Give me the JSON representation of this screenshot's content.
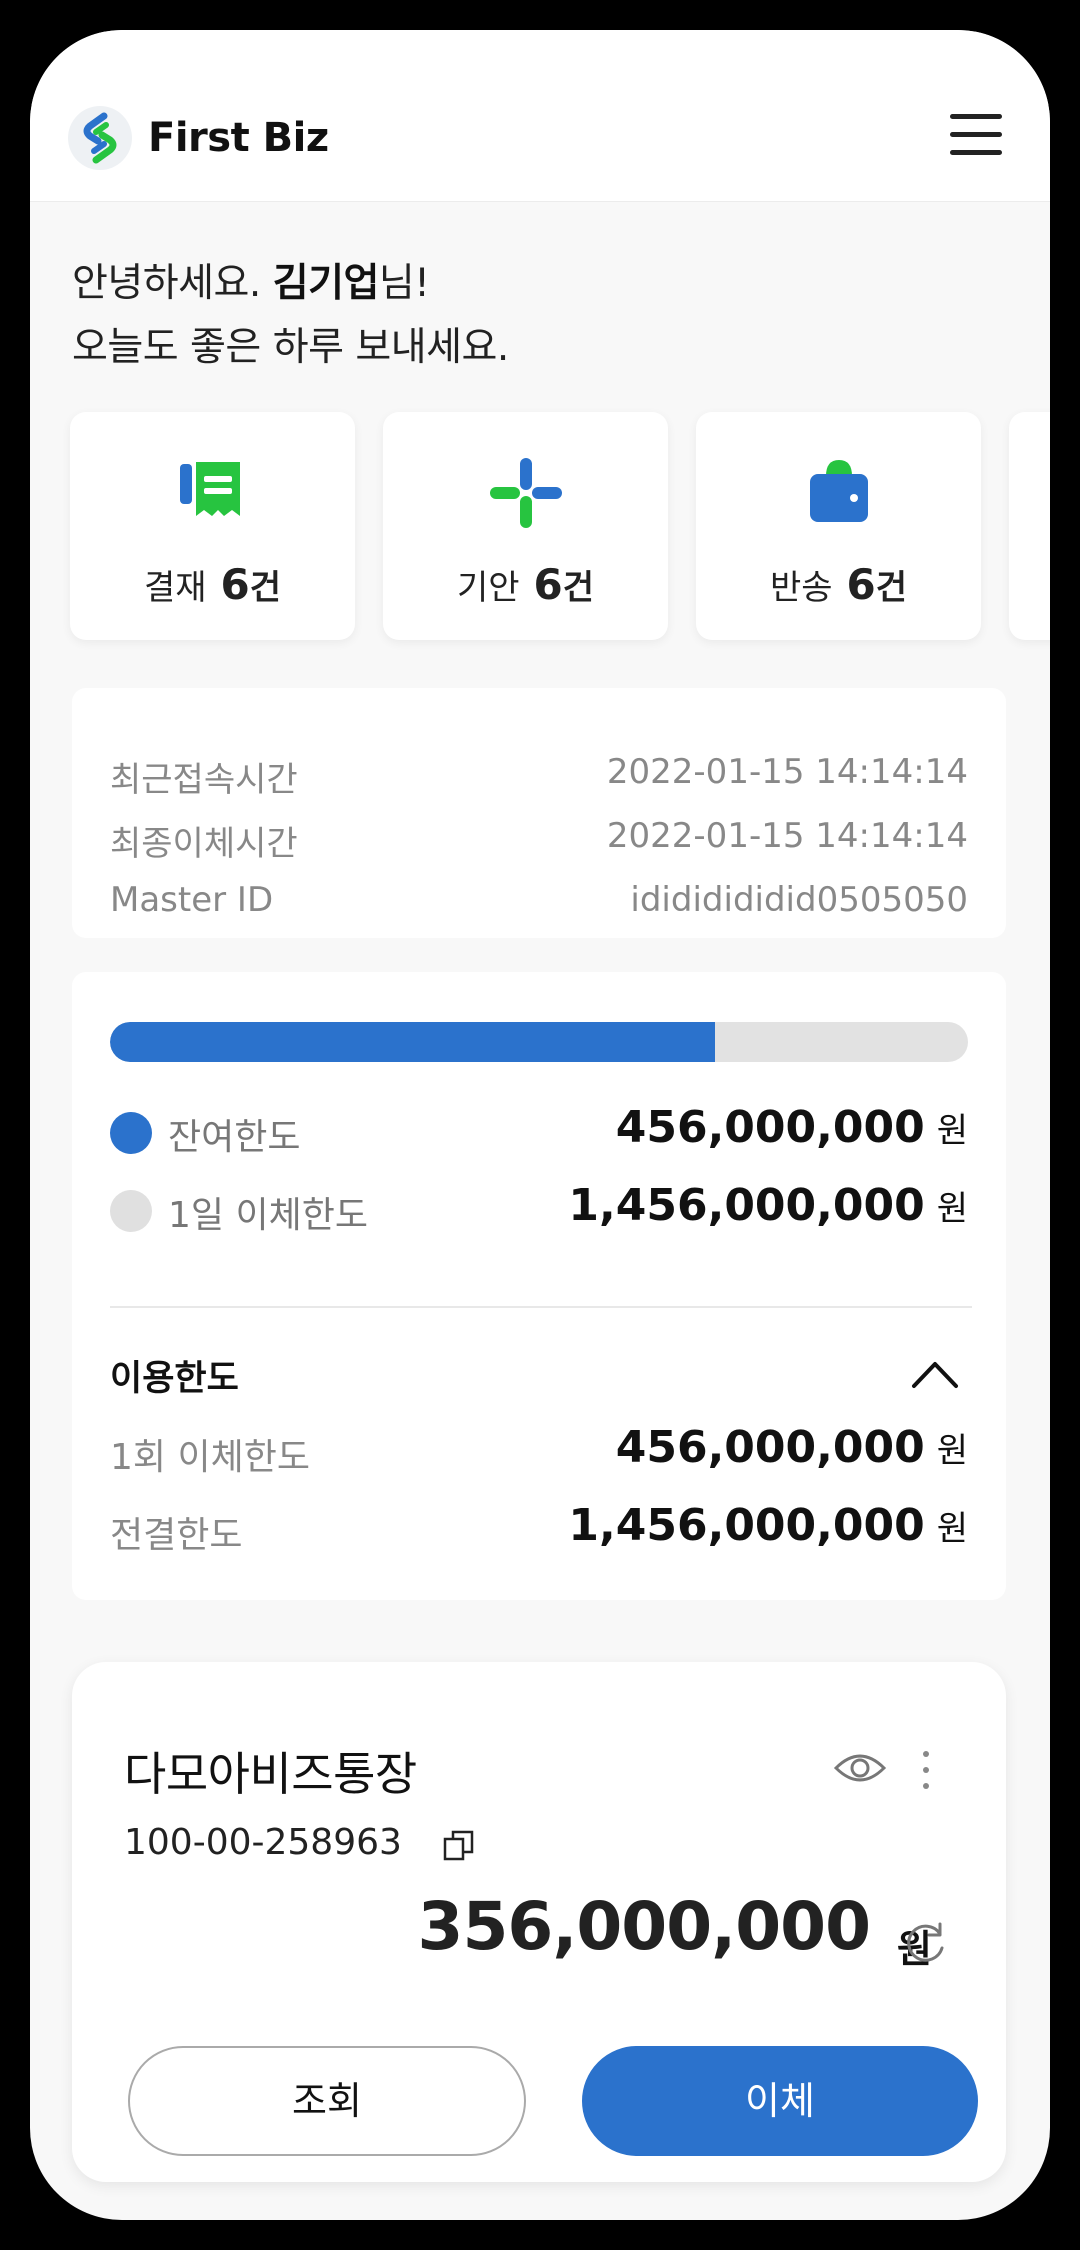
{
  "header": {
    "title": "First Biz"
  },
  "greeting": {
    "prefix": "안녕하세요. ",
    "name": "김기업",
    "suffix": "님!",
    "line2": "오늘도 좋은 하루 보내세요."
  },
  "quick_cards": [
    {
      "label": "결재",
      "count": "6",
      "unit": "건",
      "icon": "receipt-icon",
      "color": "#2b72cc"
    },
    {
      "label": "기안",
      "count": "6",
      "unit": "건",
      "icon": "plus-icon",
      "color": "#2b72cc"
    },
    {
      "label": "반송",
      "count": "6",
      "unit": "건",
      "icon": "wallet-icon",
      "color": "#2b72cc"
    }
  ],
  "info": [
    {
      "key": "최근접속시간",
      "value": "2022-01-15 14:14:14"
    },
    {
      "key": "최종이체시간",
      "value": "2022-01-15 14:14:14"
    },
    {
      "key": "Master ID",
      "value": "idididididid0505050"
    }
  ],
  "limits": {
    "progress_fraction": 0.705,
    "remaining_label": "잔여한도",
    "remaining_amount": "456,000,000",
    "daily_label": "1일 이체한도",
    "daily_amount": "1,456,000,000",
    "won": "원",
    "section_title": "이용한도",
    "per_tx_label": "1회 이체한도",
    "per_tx_amount": "456,000,000",
    "approval_label": "전결한도",
    "approval_amount": "1,456,000,000"
  },
  "account": {
    "name": "다모아비즈통장",
    "number": "100-00-258963",
    "balance": "356,000,000",
    "won": "원",
    "view_button": "조회",
    "transfer_button": "이체"
  },
  "colors": {
    "accent": "#2b72cc",
    "green": "#27c440",
    "track": "#e2e2e2"
  }
}
